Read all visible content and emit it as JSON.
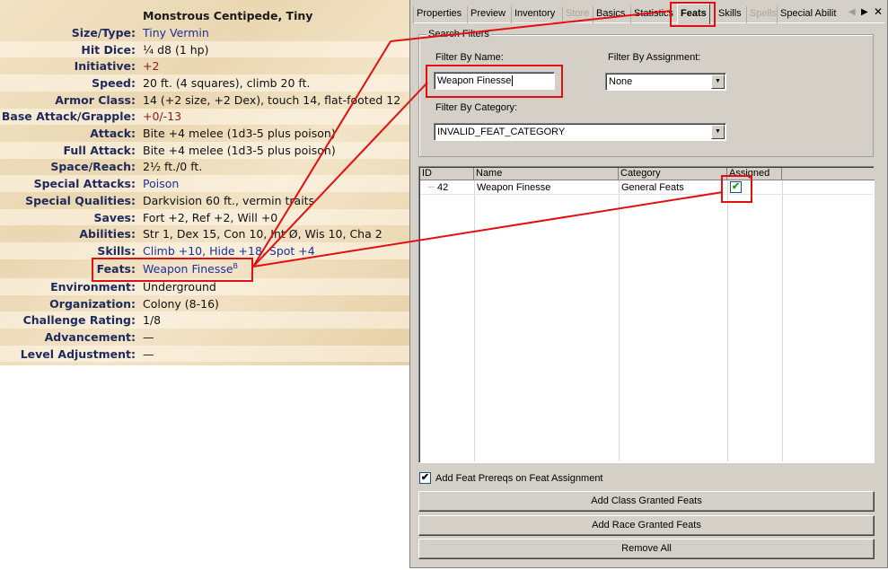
{
  "statblock": {
    "title": "Monstrous Centipede, Tiny",
    "rows": [
      {
        "label": "Size/Type:",
        "value": "Tiny Vermin"
      },
      {
        "label": "Hit Dice:",
        "value": "¼ d8 (1 hp)"
      },
      {
        "label": "Initiative:",
        "value": "+2"
      },
      {
        "label": "Speed:",
        "value": "20 ft. (4 squares), climb 20 ft."
      },
      {
        "label": "Armor Class:",
        "value": "14 (+2 size, +2 Dex), touch 14, flat-footed 12"
      },
      {
        "label": "Base Attack/Grapple:",
        "value": "+0/-13"
      },
      {
        "label": "Attack:",
        "value": "Bite +4 melee (1d3-5 plus poison)"
      },
      {
        "label": "Full Attack:",
        "value": "Bite +4 melee (1d3-5 plus poison)"
      },
      {
        "label": "Space/Reach:",
        "value": "2½ ft./0 ft."
      },
      {
        "label": "Special Attacks:",
        "value": "Poison"
      },
      {
        "label": "Special Qualities:",
        "value": "Darkvision 60 ft., vermin traits"
      },
      {
        "label": "Saves:",
        "value": "Fort +2, Ref +2, Will +0"
      },
      {
        "label": "Abilities:",
        "value": "Str 1, Dex 15, Con 10, Int Ø, Wis 10, Cha 2"
      },
      {
        "label": "Skills:",
        "value": "Climb +10, Hide +18, Spot +4"
      },
      {
        "label": "Feats:",
        "value": "Weapon Finesse",
        "sup": "B"
      },
      {
        "label": "Environment:",
        "value": "Underground"
      },
      {
        "label": "Organization:",
        "value": "Colony (8-16)"
      },
      {
        "label": "Challenge Rating:",
        "value": "1/8"
      },
      {
        "label": "Advancement:",
        "value": "—"
      },
      {
        "label": "Level Adjustment:",
        "value": "—"
      }
    ]
  },
  "editor": {
    "tabs": [
      "Properties",
      "Preview",
      "Inventory",
      "Store",
      "Basics",
      "Statistics",
      "Feats",
      "Skills",
      "Spells",
      "Special Abilit"
    ],
    "active_tab": "Feats",
    "disabled_tabs": [
      "Store",
      "Spells"
    ],
    "search_filters": {
      "legend": "Search Filters",
      "filter_by_name_label": "Filter By Name:",
      "filter_by_name_value": "Weapon Finesse",
      "filter_by_assignment_label": "Filter By Assignment:",
      "filter_by_assignment_value": "None",
      "filter_by_category_label": "Filter By Category:",
      "filter_by_category_value": "INVALID_FEAT_CATEGORY"
    },
    "grid": {
      "columns": [
        "ID",
        "Name",
        "Category",
        "Assigned"
      ],
      "rows": [
        {
          "id": "42",
          "name": "Weapon Finesse",
          "category": "General Feats",
          "assigned": true
        }
      ]
    },
    "prereq_checkbox_label": "Add Feat Prereqs on Feat Assignment",
    "prereq_checked": true,
    "buttons": {
      "add_class": "Add Class Granted Feats",
      "add_race": "Add Race Granted Feats",
      "remove_all": "Remove All"
    }
  },
  "colors": {
    "annotation": "#e01010",
    "link": "#1d2f9c",
    "label": "#1f2a5c"
  }
}
